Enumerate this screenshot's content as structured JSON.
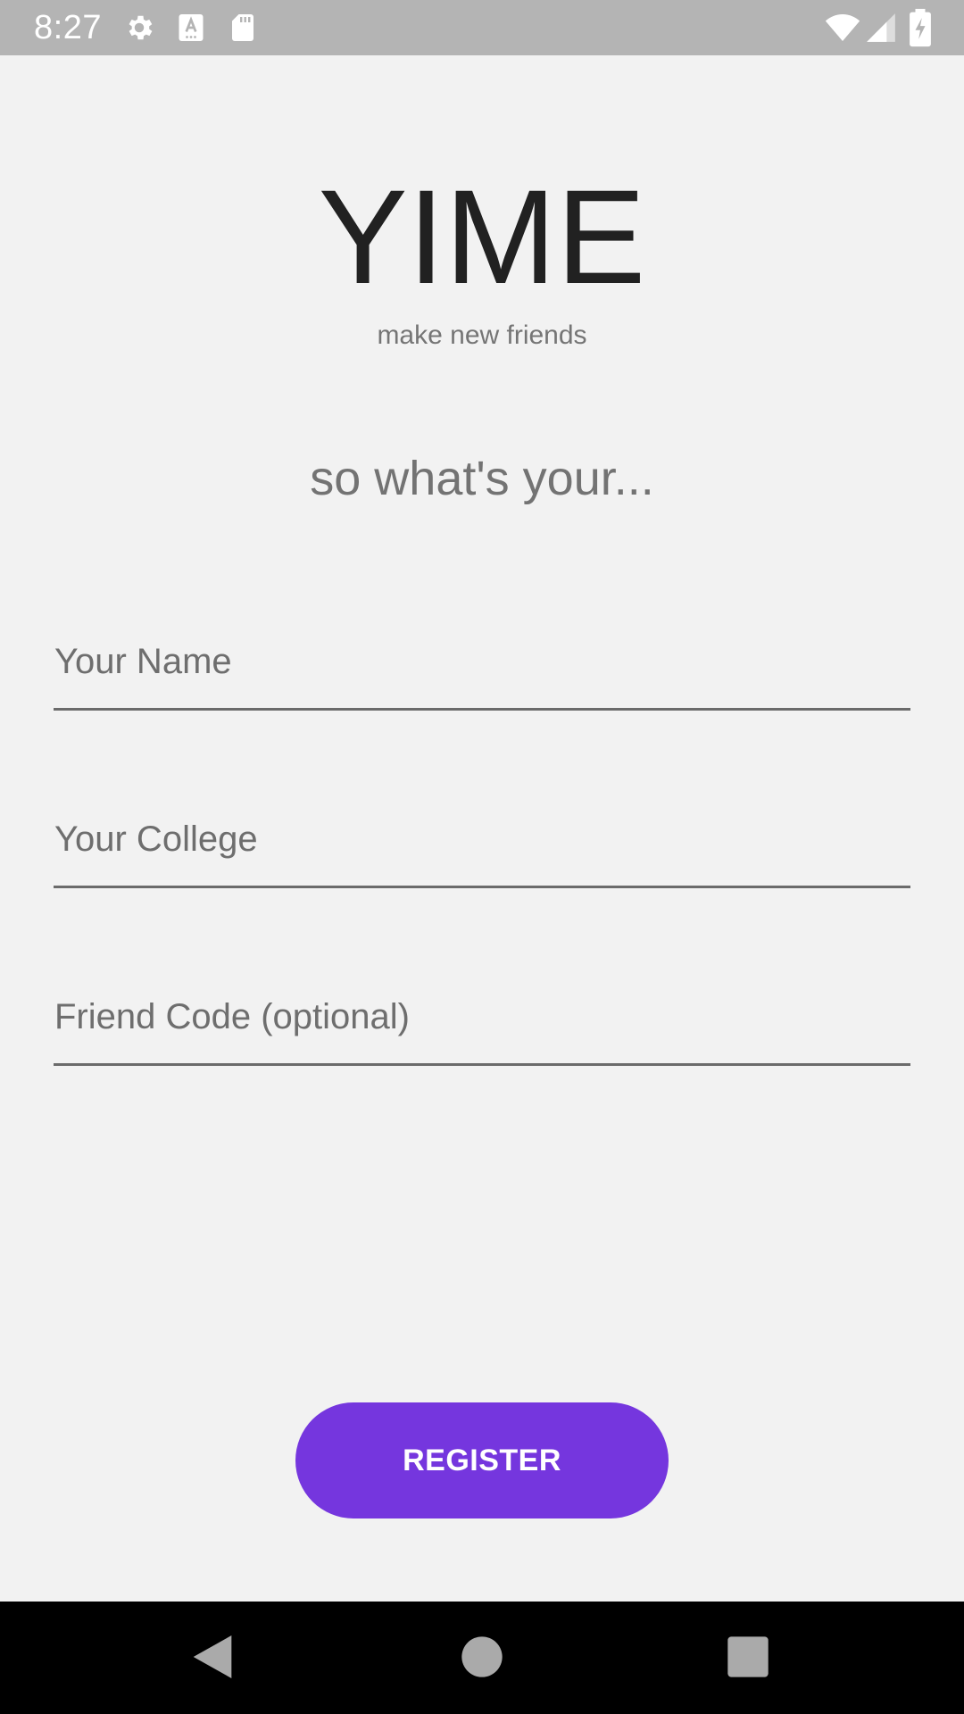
{
  "status_bar": {
    "time": "8:27",
    "left_icons": [
      "gear-icon",
      "keyboard-a-icon",
      "sd-card-icon"
    ],
    "right_icons": [
      "wifi-icon",
      "signal-icon",
      "battery-charging-icon"
    ],
    "background_color": "#b4b4b4"
  },
  "app": {
    "title": "YIME",
    "subtitle": "make new friends",
    "prompt": "so what's your..."
  },
  "form": {
    "name_placeholder": "Your Name",
    "college_placeholder": "Your College",
    "friend_code_placeholder": "Friend Code (optional)",
    "register_label": "REGISTER",
    "accent_color": "#7536de"
  },
  "nav_bar": {
    "buttons": [
      "back-icon",
      "home-icon",
      "recents-icon"
    ]
  }
}
